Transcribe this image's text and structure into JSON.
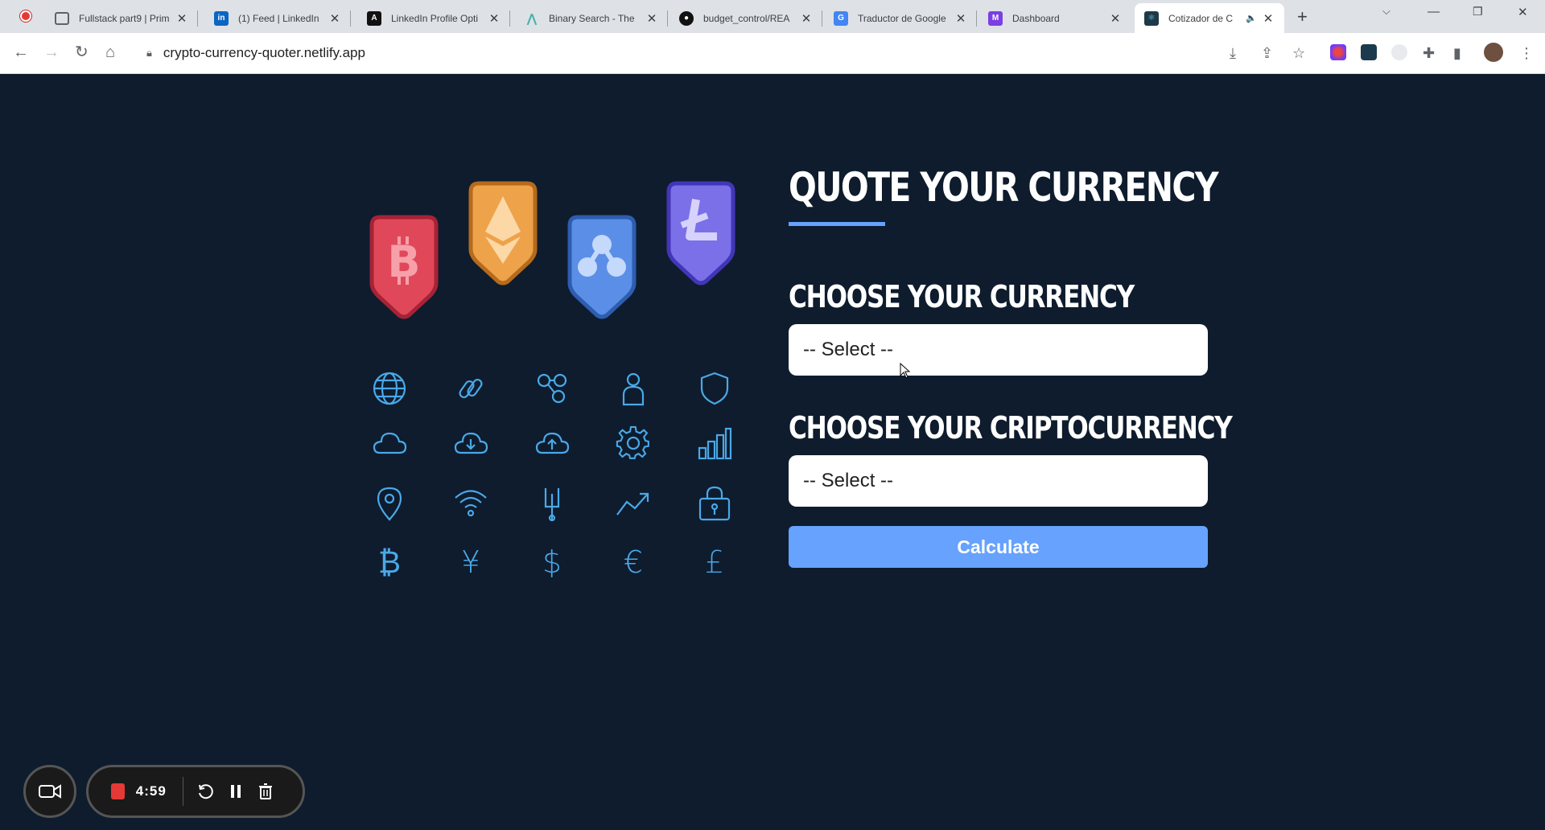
{
  "browser": {
    "tabs": [
      {
        "title": "Fullstack part9 | Prim",
        "favicon": "page-icon",
        "color": "#5f6368",
        "active": false
      },
      {
        "title": "(1) Feed | LinkedIn",
        "favicon": "linkedin-icon",
        "color": "#0a66c2",
        "active": false
      },
      {
        "title": "LinkedIn Profile Opti",
        "favicon": "a-logo-icon",
        "color": "#111111",
        "active": false
      },
      {
        "title": "Binary Search - The",
        "favicon": "algo-icon",
        "color": "#3fb0ac",
        "active": false
      },
      {
        "title": "budget_control/REA",
        "favicon": "github-icon",
        "color": "#111111",
        "active": false
      },
      {
        "title": "Traductor de Google",
        "favicon": "translate-icon",
        "color": "#4285f4",
        "active": false
      },
      {
        "title": "Dashboard",
        "favicon": "dashboard-icon",
        "color": "#7b3fe4",
        "active": false
      },
      {
        "title": "Cotizador de C",
        "favicon": "react-icon",
        "color": "#1e3a4a",
        "active": true
      }
    ],
    "new_tab_label": "+",
    "url": "crypto-currency-quoter.netlify.app"
  },
  "page": {
    "title": "QUOTE YOUR CURRENCY",
    "currency_label": "CHOOSE YOUR CURRENCY",
    "currency_select": "-- Select --",
    "crypto_label": "CHOOSE YOUR CRIPTOCURRENCY",
    "crypto_select": "-- Select --",
    "calculate_button": "Calculate",
    "accent_color": "#66a2fe",
    "background_color": "#0e1c2d"
  },
  "badges": [
    {
      "symbol": "bitcoin-icon",
      "color": "#e0485a"
    },
    {
      "symbol": "ethereum-icon",
      "color": "#eea24a"
    },
    {
      "symbol": "ripple-icon",
      "color": "#5b8ee6"
    },
    {
      "symbol": "litecoin-icon",
      "color": "#7b70e8"
    }
  ],
  "icon_grid": {
    "glyphs": {
      "bitcoin": "₿",
      "yen": "¥",
      "dollar": "$",
      "euro": "€",
      "pound": "£"
    }
  },
  "recorder": {
    "time": "4:59"
  }
}
